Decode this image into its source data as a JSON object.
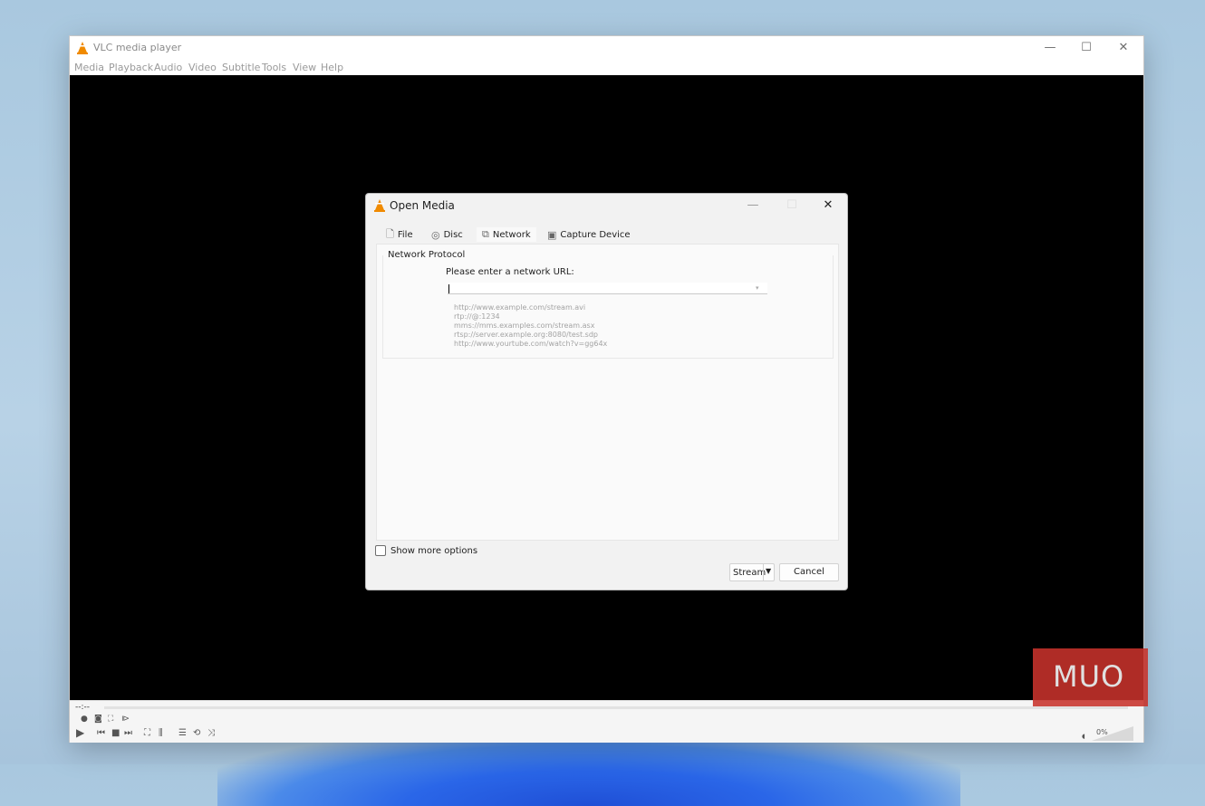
{
  "window": {
    "title": "VLC media player",
    "minimize_icon": "—",
    "maximize_icon": "☐",
    "close_icon": "✕"
  },
  "menu": [
    "Media",
    "Playback",
    "Audio",
    "Video",
    "Subtitle",
    "Tools",
    "View",
    "Help"
  ],
  "controls": {
    "time": "--:--",
    "volume": "0%"
  },
  "watermark": "MUO",
  "dialog": {
    "title": "Open Media",
    "minimize_icon": "—",
    "maximize_icon": "☐",
    "close_icon": "✕",
    "tabs": [
      {
        "label": "File",
        "icon": "file-icon"
      },
      {
        "label": "Disc",
        "icon": "disc-icon"
      },
      {
        "label": "Network",
        "icon": "network-icon",
        "active": true
      },
      {
        "label": "Capture Device",
        "icon": "capture-device-icon"
      }
    ],
    "group_label": "Network Protocol",
    "url_label": "Please enter a network URL:",
    "url_value": "",
    "examples": [
      "http://www.example.com/stream.avi",
      "rtp://@:1234",
      "mms://mms.examples.com/stream.asx",
      "rtsp://server.example.org:8080/test.sdp",
      "http://www.yourtube.com/watch?v=gg64x"
    ],
    "show_more_options": "Show more options",
    "stream_label": "Stream",
    "cancel_label": "Cancel"
  },
  "colors": {
    "watermark_bg": "#c8332c",
    "video_bg": "#000000",
    "vlc_orange": "#f08a00"
  }
}
